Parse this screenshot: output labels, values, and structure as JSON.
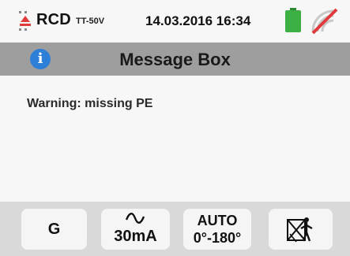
{
  "status_bar": {
    "mode": "RCD",
    "mode_sub": "TT-50V",
    "datetime": "14.03.2016  16:34",
    "icons": [
      "rcd-icon",
      "battery-icon",
      "signal-off-icon"
    ]
  },
  "titlebar": {
    "info_glyph": "i",
    "title": "Message Box"
  },
  "message": {
    "text": "Warning: missing PE"
  },
  "toolbar": {
    "btn_type": "G",
    "btn_current": "30mA",
    "btn_phase_line1": "AUTO",
    "btn_phase_line2": "0°-180°",
    "btn_touch_icon": "touch-voltage-off-icon"
  },
  "colors": {
    "titlebar": "#9e9e9e",
    "info": "#2d7fd8",
    "battery": "#3cb043",
    "signal_cross": "#e03a3a",
    "toolbar": "#d9d9d9"
  }
}
